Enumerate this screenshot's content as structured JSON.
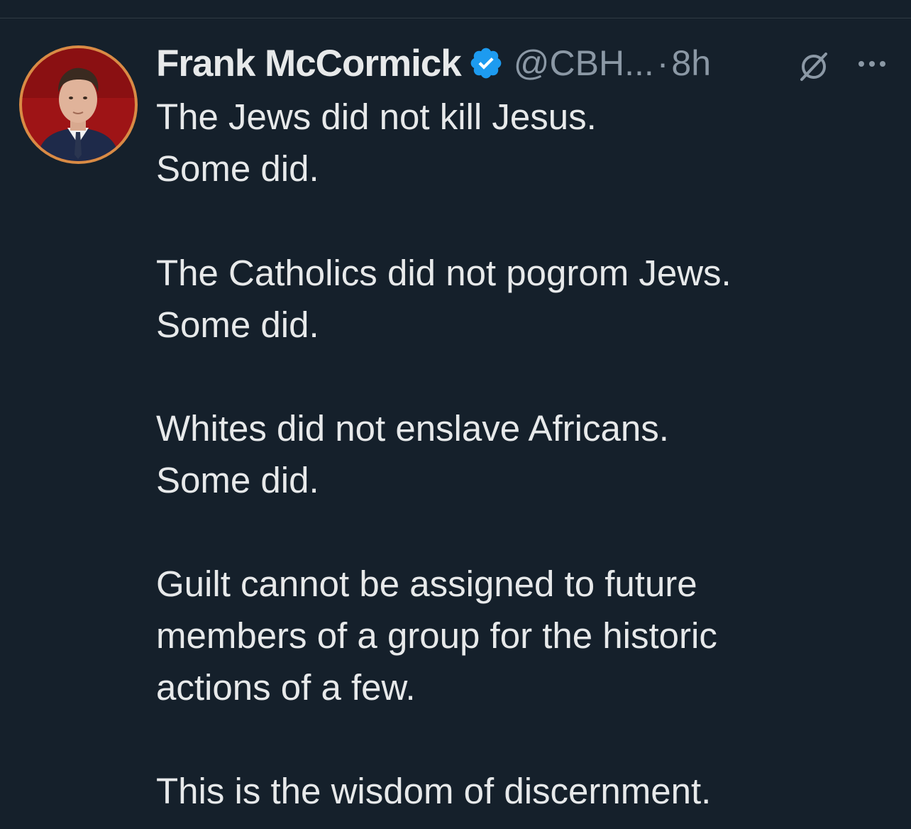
{
  "tweet": {
    "author": {
      "display_name": "Frank McCormick",
      "handle": "@CBH...",
      "verified": true
    },
    "separator": "·",
    "time": "8h",
    "lines": [
      "The Jews did not kill Jesus.",
      "Some did.",
      "The Catholics did not pogrom Jews.",
      "Some did.",
      "Whites did not enslave Africans.",
      "Some did.",
      "Guilt cannot be assigned to future",
      "members of a group for the historic",
      "actions of a few.",
      "This is the wisdom of discernment."
    ]
  },
  "icons": {
    "verified": "verified-badge-icon",
    "grok": "grok-icon",
    "more": "more-options-icon"
  },
  "colors": {
    "background": "#15202b",
    "text": "#e7e9ea",
    "secondary_text": "#8b98a5",
    "verified_blue": "#1d9bf0",
    "avatar_ring": "#d98b45"
  }
}
